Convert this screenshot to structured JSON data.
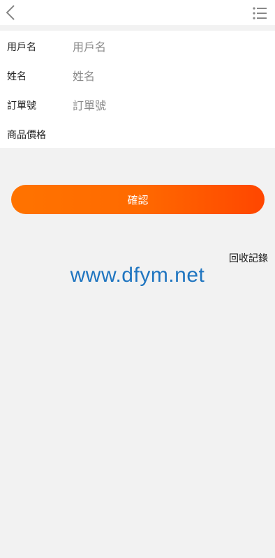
{
  "header": {
    "back_icon": "chevron-left-icon",
    "menu_icon": "list-menu-icon"
  },
  "form": {
    "fields": [
      {
        "label": "用戶名",
        "placeholder": "用戶名",
        "value": ""
      },
      {
        "label": "姓名",
        "placeholder": "姓名",
        "value": ""
      },
      {
        "label": "訂單號",
        "placeholder": "訂單號",
        "value": ""
      },
      {
        "label": "商品價格",
        "placeholder": "",
        "value": ""
      }
    ]
  },
  "confirm_button": {
    "label": "確認",
    "gradient_start": "#ff7300",
    "gradient_end": "#ff4600"
  },
  "records_link": "回收記錄",
  "watermark": {
    "text": "www.dfym.net",
    "color": "#1f75c0"
  },
  "colors": {
    "page_background": "#f2f2f2",
    "card_background": "#ffffff"
  }
}
